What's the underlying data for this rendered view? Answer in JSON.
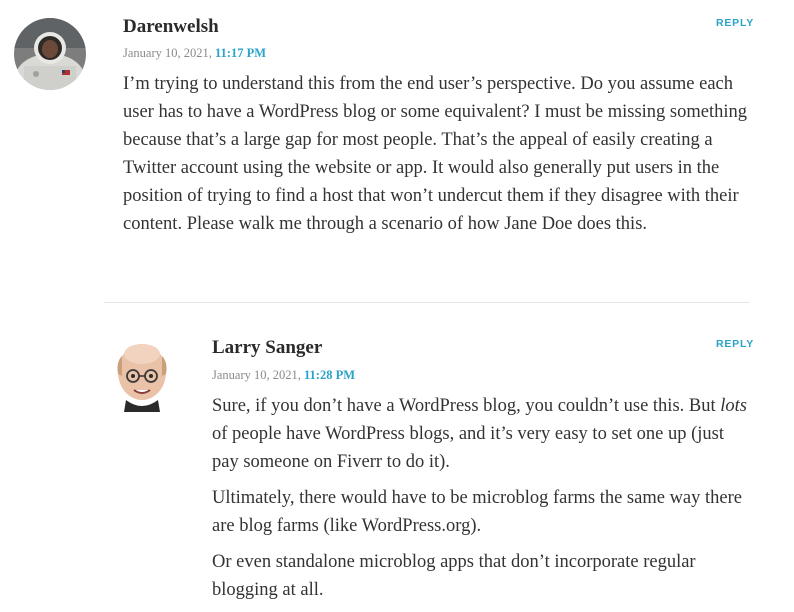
{
  "comments": [
    {
      "author": "Darenwelsh",
      "date": "January 10, 2021,",
      "time": "11:17 PM",
      "reply_label": "REPLY",
      "avatar_icon": "astronaut-avatar-icon",
      "paragraphs": [
        "I’m trying to understand this from the end user’s perspective. Do you assume each user has to have a WordPress blog or some equivalent? I must be missing something because that’s a large gap for most people. That’s the appeal of easily creating a Twitter account using the website or app. It would also generally put users in the position of trying to find a host that won’t undercut them if they disagree with their content. Please walk me through a scenario of how Jane Doe does this."
      ]
    },
    {
      "author": "Larry Sanger",
      "date": "January 10, 2021,",
      "time": "11:28 PM",
      "reply_label": "REPLY",
      "avatar_icon": "bald-man-avatar-icon",
      "p1_before": "Sure, if you don’t have a WordPress blog, you couldn’t use this. But ",
      "p1_em": "lots",
      "p1_after": " of people have WordPress blogs, and it’s very easy to set one up (just pay someone on Fiverr to do it).",
      "p2": "Ultimately, there would have to be microblog farms the same way there are blog farms (like WordPress.org).",
      "p3": "Or even standalone microblog apps that don’t incorporate regular blogging at all."
    }
  ],
  "colors": {
    "accent": "#2aa3c7",
    "text": "#333333",
    "meta": "#8a8a8a",
    "divider": "#e6e6e6"
  }
}
